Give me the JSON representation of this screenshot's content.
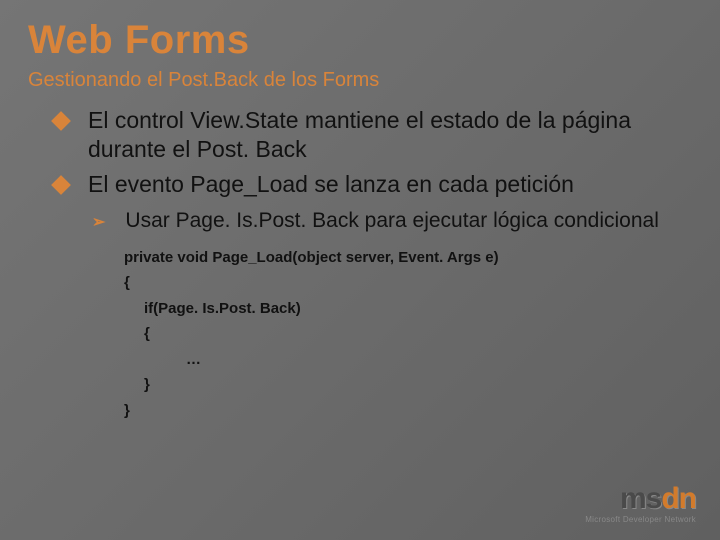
{
  "title": "Web Forms",
  "subtitle": "Gestionando el Post.Back de los Forms",
  "bullets": [
    "El control View.State mantiene el estado de la página durante el Post. Back",
    "El evento Page_Load se lanza en cada petición"
  ],
  "sub_bullet": "Usar Page. Is.Post. Back para ejecutar lógica condicional",
  "code": {
    "l1": "private void Page_Load(object server, Event. Args e)",
    "l2": "{",
    "l3": "if(Page. Is.Post. Back)",
    "l4": "{",
    "l5": "…",
    "l6": "}",
    "l7": "}"
  },
  "logo": {
    "brand_prefix": "ms",
    "brand_suffix": "dn",
    "tagline": "Microsoft Developer Network"
  }
}
